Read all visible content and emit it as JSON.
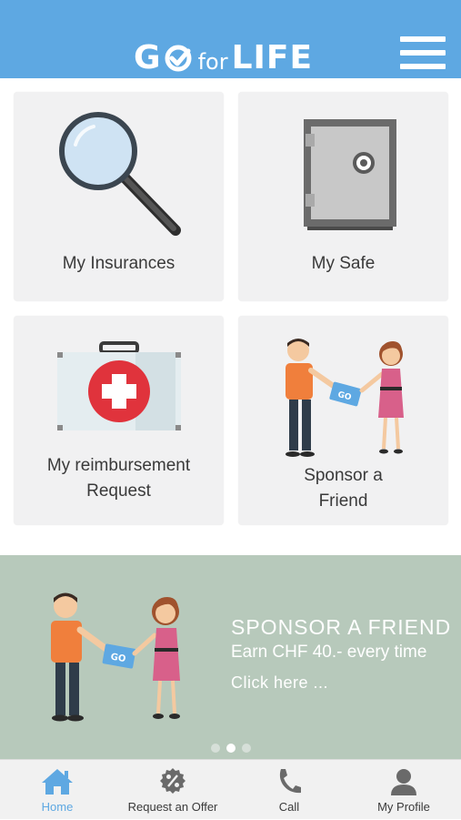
{
  "header": {
    "logo": {
      "go": "GO",
      "for": "for",
      "life": "LIFE"
    },
    "menu_icon": "hamburger-menu-icon",
    "color": "#5ea8e2"
  },
  "tiles": [
    {
      "label": "My Insurances",
      "icon": "magnifier-icon"
    },
    {
      "label": "My Safe",
      "icon": "safe-icon"
    },
    {
      "label": "My reimbursement",
      "label2": "Request",
      "icon": "first-aid-kit-icon"
    },
    {
      "label": "Sponsor a",
      "label2": "Friend",
      "icon": "sponsor-illustration"
    }
  ],
  "banner": {
    "title": "SPONSOR A FRIEND",
    "subtitle": "Earn CHF 40.- every time",
    "cta": "Click here ...",
    "card_text": "GO",
    "slides": 3,
    "active_slide": 2
  },
  "tabbar": {
    "items": [
      {
        "label": "Home",
        "icon": "home-icon",
        "active": true
      },
      {
        "label": "Request an Offer",
        "icon": "percent-badge-icon",
        "active": false
      },
      {
        "label": "Call",
        "icon": "phone-icon",
        "active": false
      },
      {
        "label": "My Profile",
        "icon": "person-icon",
        "active": false
      }
    ]
  },
  "colors": {
    "accent": "#5ea8e2",
    "banner_bg": "#b7c9bb",
    "tile_bg": "#f1f1f2",
    "red_cross": "#e0333c"
  }
}
